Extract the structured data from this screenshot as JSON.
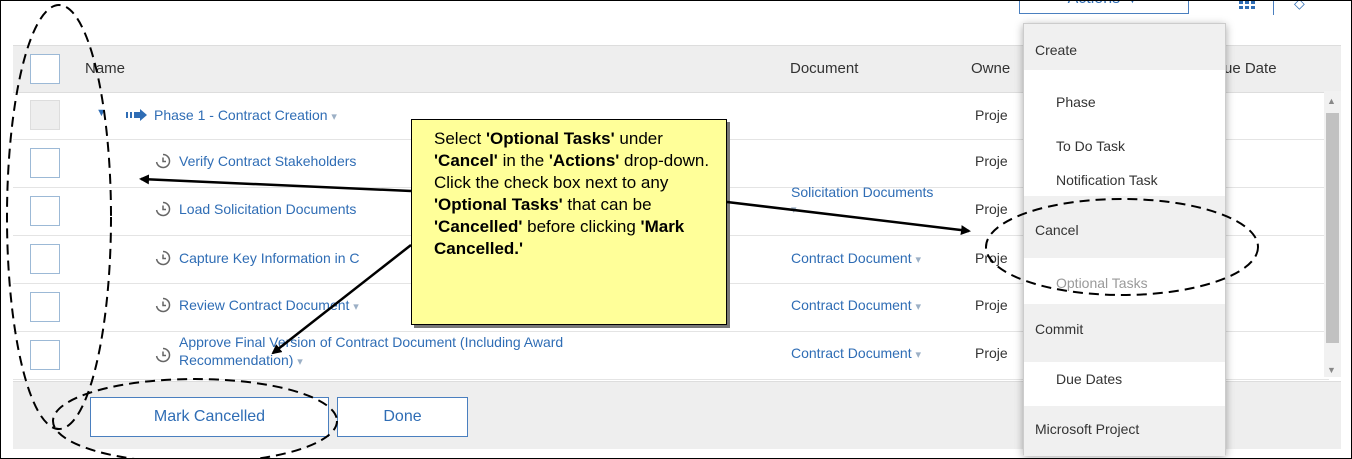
{
  "toolbar": {
    "actions_label": "Actions ▼",
    "chevron": "◇"
  },
  "table": {
    "headers": {
      "name": "Name",
      "document": "Document",
      "owner": "Owne",
      "due_date": "ue Date"
    },
    "rows": [
      {
        "name": "Phase 1 - Contract Creation",
        "document": "",
        "owner": "Proje"
      },
      {
        "name": "Verify Contract Stakeholders",
        "document": "",
        "owner": "Proje"
      },
      {
        "name": "Load Solicitation Documents",
        "document": "Solicitation Documents",
        "owner": "Proje"
      },
      {
        "name": "Capture Key Information in C",
        "document": "Contract Document",
        "owner": "Proje"
      },
      {
        "name": "Review Contract Document",
        "document": "Contract Document",
        "owner": "Proje"
      },
      {
        "name_line1": "Approve Final Version of Co",
        "name_line1_tail": "ntract Document (Including Award",
        "name_line2": "Recommendation)",
        "document": "Contract Document",
        "owner": "Proje"
      }
    ],
    "caret": "▾"
  },
  "footer": {
    "mark_cancelled": "Mark Cancelled",
    "done": "Done"
  },
  "menu": {
    "items": [
      {
        "label": "Create",
        "kind": "head"
      },
      {
        "label": "Phase",
        "kind": "item"
      },
      {
        "label": "To Do Task",
        "kind": "item"
      },
      {
        "label": "Notification Task",
        "kind": "item"
      },
      {
        "label": "Cancel",
        "kind": "head"
      },
      {
        "label": "Optional Tasks",
        "kind": "disabled"
      },
      {
        "label": "Commit",
        "kind": "head"
      },
      {
        "label": "Due Dates",
        "kind": "item"
      },
      {
        "label": "Microsoft Project",
        "kind": "head"
      }
    ]
  },
  "callout": {
    "t1": "Select ",
    "b1": "'Optional Tasks'",
    "t2": "under ",
    "b2": "'Cancel'",
    "t3": " in the",
    "b3": "'Actions'",
    "t4": " drop-down. Click the check box next to any",
    "b4": "'Optional Tasks'",
    "t5": " that can be ",
    "b5": "'Cancelled'",
    "t6": " before clicking ",
    "b6": "'Mark Cancelled.'"
  },
  "colors": {
    "link": "#2f6db5",
    "callout_bg": "#ffff99",
    "header_bg": "#eeeeee"
  }
}
